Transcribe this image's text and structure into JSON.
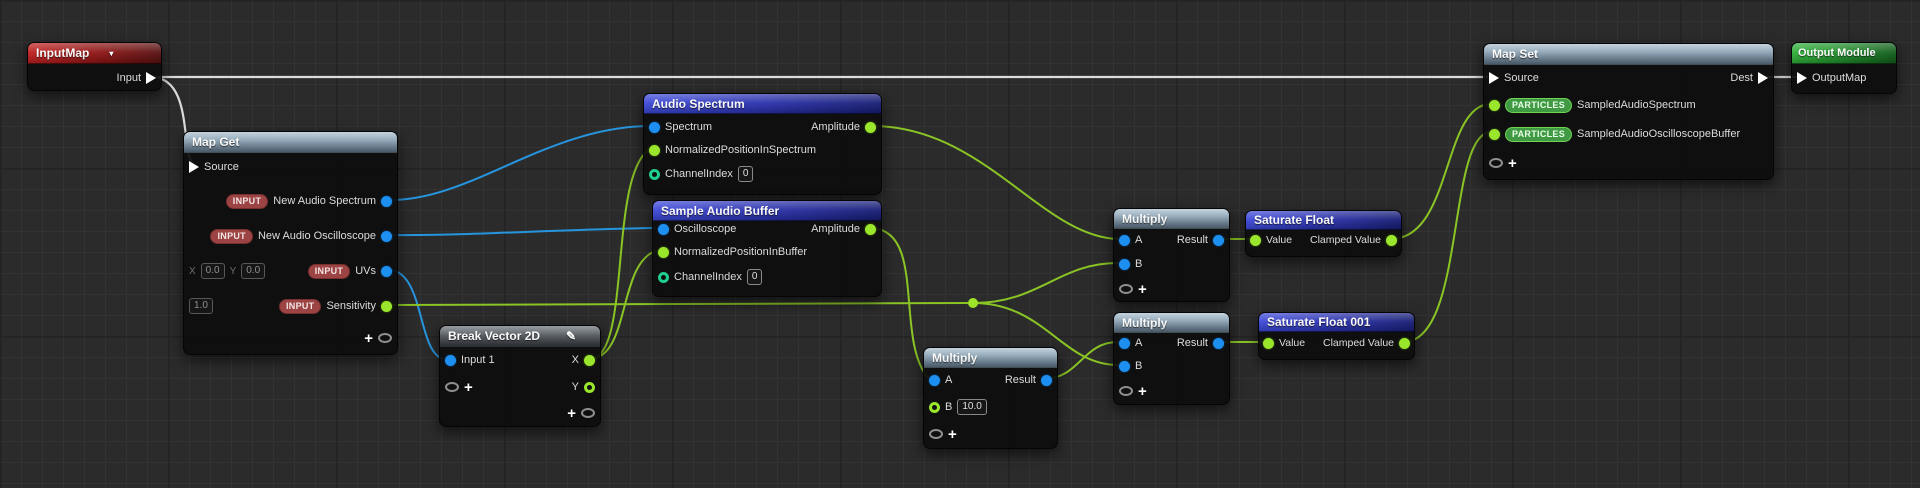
{
  "colors": {
    "wire_white": "#dcdcdc",
    "wire_blue": "#2795dd",
    "wire_green": "#8ac425",
    "pin_blue": "#1d8ff0",
    "pin_green": "#9ae62c",
    "pin_teal": "#1fcf8e",
    "header_red": "#bf2020",
    "header_map_gray_blue": "#a9c0d0",
    "header_blue": "#3d49d8",
    "header_green": "#2fb13a"
  },
  "icons": {
    "add_pin": "+",
    "dropdown": "▾",
    "edit": "✎"
  },
  "nodes": {
    "input_map": {
      "title": "InputMap",
      "output_pin": "Input"
    },
    "map_get": {
      "title": "Map Get",
      "source_pin": "Source",
      "row_spectrum": {
        "badge": "INPUT",
        "label": "New Audio Spectrum"
      },
      "row_oscilloscope": {
        "badge": "INPUT",
        "label": "New Audio Oscilloscope"
      },
      "row_uvs": {
        "badge": "INPUT",
        "label": "UVs",
        "x_label": "X",
        "x_value": "0.0",
        "y_label": "Y",
        "y_value": "0.0"
      },
      "row_sensitivity": {
        "badge": "INPUT",
        "label": "Sensitivity",
        "value": "1.0"
      }
    },
    "audio_spectrum": {
      "title": "Audio Spectrum",
      "in_spectrum": "Spectrum",
      "out_amplitude": "Amplitude",
      "in_normalized": "NormalizedPositionInSpectrum",
      "in_channel": "ChannelIndex",
      "channel_value": "0"
    },
    "sample_audio_buffer": {
      "title": "Sample Audio Buffer",
      "in_oscilloscope": "Oscilloscope",
      "out_amplitude": "Amplitude",
      "in_normalized": "NormalizedPositionInBuffer",
      "in_channel": "ChannelIndex",
      "channel_value": "0"
    },
    "break_vector_2d": {
      "title": "Break Vector 2D",
      "in_1": "Input 1",
      "out_x": "X",
      "out_y": "Y"
    },
    "multiply_scale": {
      "title": "Multiply",
      "a": "A",
      "b": "B",
      "b_value": "10.0",
      "result": "Result"
    },
    "multiply_spectrum": {
      "title": "Multiply",
      "a": "A",
      "b": "B",
      "result": "Result"
    },
    "multiply_buffer": {
      "title": "Multiply",
      "a": "A",
      "b": "B",
      "result": "Result"
    },
    "saturate_float": {
      "title": "Saturate Float",
      "value": "Value",
      "clamped": "Clamped Value"
    },
    "saturate_float_001": {
      "title": "Saturate Float 001",
      "value": "Value",
      "clamped": "Clamped Value"
    },
    "map_set": {
      "title": "Map Set",
      "source_pin": "Source",
      "dest_pin": "Dest",
      "row_spectrum": {
        "badge": "PARTICLES",
        "label": "SampledAudioSpectrum"
      },
      "row_buffer": {
        "badge": "PARTICLES",
        "label": "SampledAudioOscilloscopeBuffer"
      }
    },
    "output_module": {
      "title": "Output Module",
      "input_pin": "OutputMap"
    }
  }
}
